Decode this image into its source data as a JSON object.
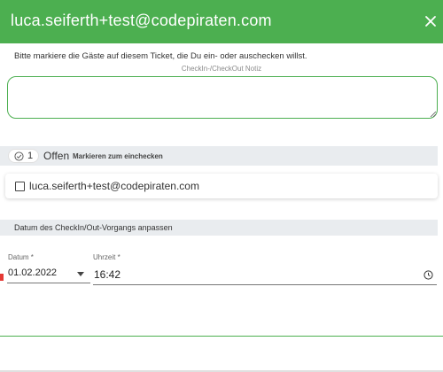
{
  "dialog": {
    "title": "luca.seiferth+test@codepiraten.com",
    "close_icon": "close-icon"
  },
  "instruction": "Bitte markiere die Gäste auf diesem Ticket, die Du ein- oder auschecken willst.",
  "note": {
    "label": "CheckIn-/CheckOut Notiz",
    "value": ""
  },
  "status": {
    "count": "1",
    "label": "Offen",
    "hint": "Markieren zum einchecken",
    "icon": "check-circle-icon"
  },
  "guests": [
    {
      "email": "luca.seiferth+test@codepiraten.com",
      "checked": false
    }
  ],
  "date_section": {
    "title": "Datum des CheckIn/Out-Vorgangs anpassen",
    "date_label": "Datum",
    "date_value": "01.02.2022",
    "time_label": "Uhrzeit",
    "time_value": "16:42",
    "required_mark": "*"
  },
  "colors": {
    "accent": "#4caf50",
    "section_bg": "#e9ecef",
    "marker": "#e53935"
  }
}
